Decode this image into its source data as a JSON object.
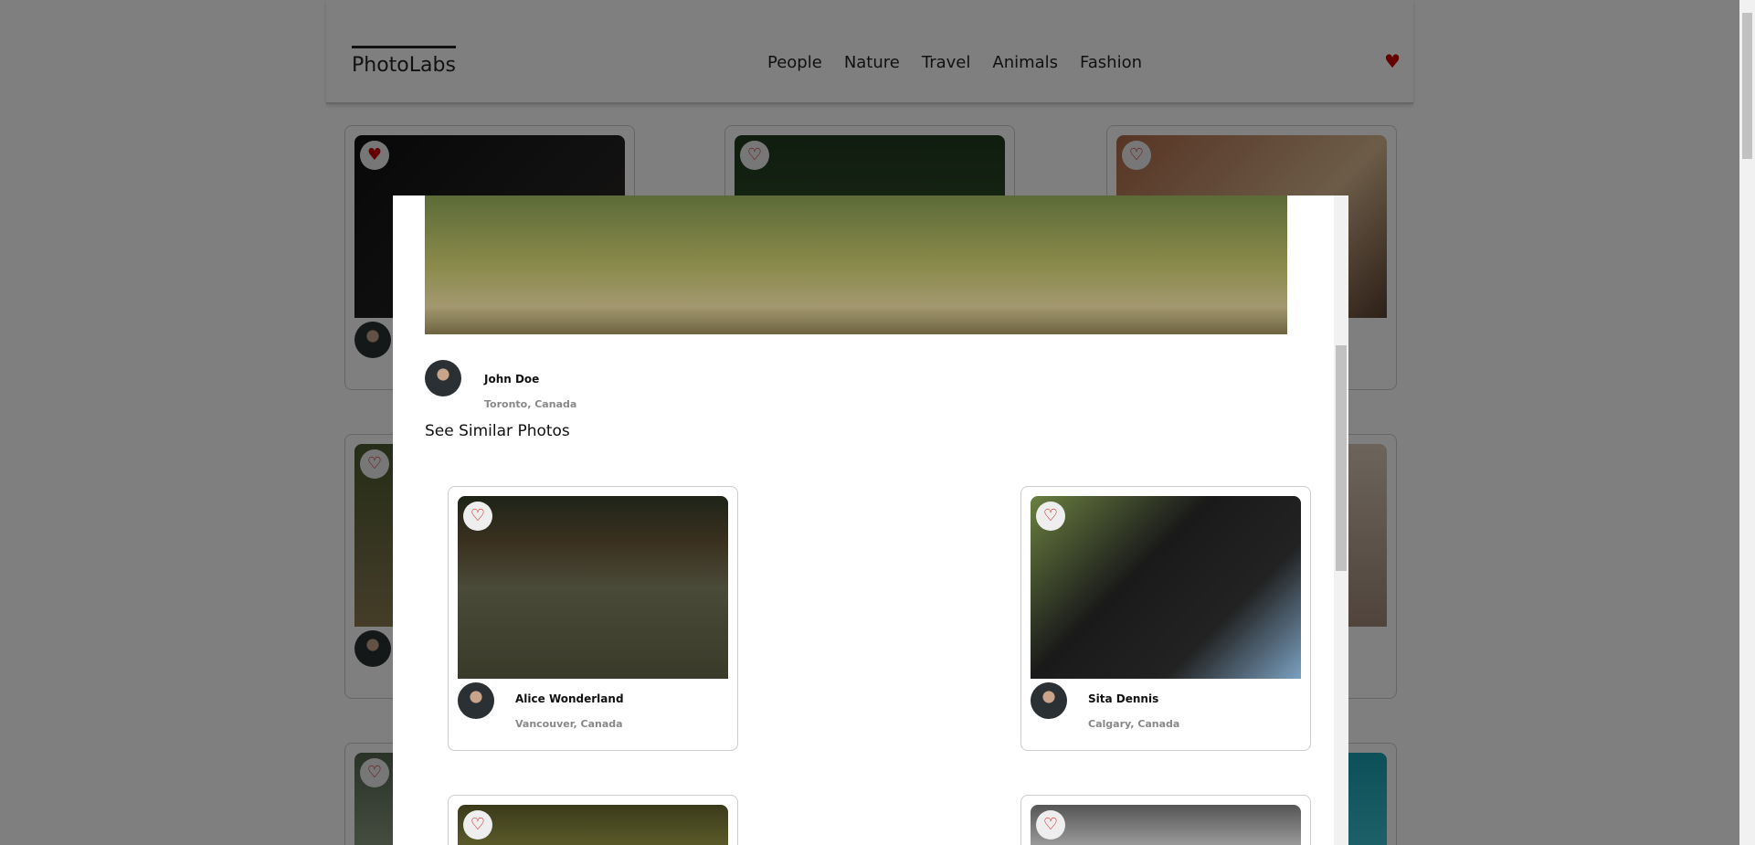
{
  "header": {
    "logo": "PhotoLabs",
    "topics": [
      "People",
      "Nature",
      "Travel",
      "Animals",
      "Fashion"
    ],
    "fav_icon": "heart-icon",
    "fav_color": "#cc0000"
  },
  "grid_cards": [
    {
      "liked": true
    },
    {
      "liked": false
    },
    {
      "liked": false
    },
    {
      "liked": false
    },
    {
      "liked": false
    },
    {
      "liked": false
    },
    {
      "liked": false
    },
    {
      "liked": false
    },
    {
      "liked": false
    }
  ],
  "modal": {
    "author": {
      "name": "John Doe",
      "location": "Toronto, Canada"
    },
    "similar_title": "See Similar Photos",
    "similar": [
      {
        "name": "Alice Wonderland",
        "location": "Vancouver, Canada"
      },
      {
        "name": "Sita Dennis",
        "location": "Calgary, Canada"
      },
      {
        "name": "",
        "location": ""
      },
      {
        "name": "",
        "location": ""
      }
    ]
  }
}
